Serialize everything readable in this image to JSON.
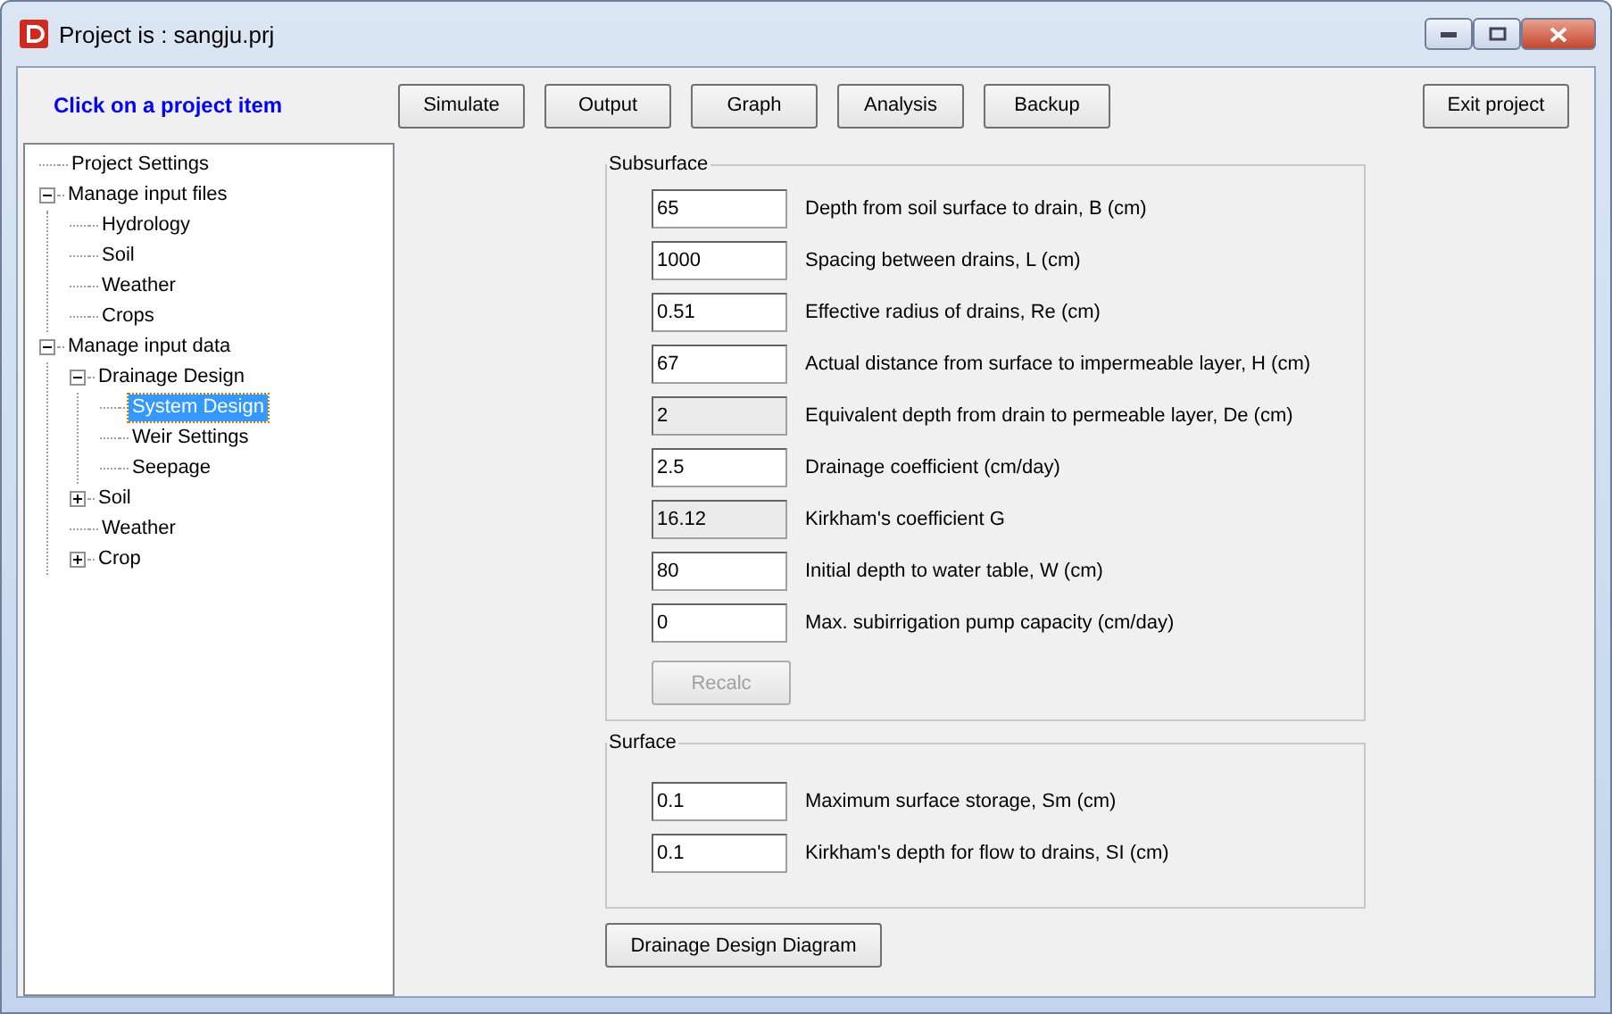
{
  "window": {
    "title": "Project is : sangju.prj"
  },
  "hint": "Click on a project item",
  "toolbar": [
    {
      "label": "Simulate"
    },
    {
      "label": "Output"
    },
    {
      "label": "Graph"
    },
    {
      "label": "Analysis"
    },
    {
      "label": "Backup"
    }
  ],
  "exit_button": "Exit project",
  "tree": [
    {
      "label": "Project Settings",
      "selected": false
    },
    {
      "label": "Manage input files",
      "selected": false,
      "expanded": true,
      "children": [
        {
          "label": "Hydrology",
          "selected": false
        },
        {
          "label": "Soil",
          "selected": false
        },
        {
          "label": "Weather",
          "selected": false
        },
        {
          "label": "Crops",
          "selected": false
        }
      ]
    },
    {
      "label": "Manage input data",
      "selected": false,
      "expanded": true,
      "children": [
        {
          "label": "Drainage Design",
          "selected": false,
          "expanded": true,
          "children": [
            {
              "label": "System Design",
              "selected": true
            },
            {
              "label": "Weir Settings",
              "selected": false
            },
            {
              "label": "Seepage",
              "selected": false
            }
          ]
        },
        {
          "label": "Soil",
          "selected": false,
          "expanded": false
        },
        {
          "label": "Weather",
          "selected": false
        },
        {
          "label": "Crop",
          "selected": false,
          "expanded": false
        }
      ]
    }
  ],
  "subsurface": {
    "title": "Subsurface",
    "fields": [
      {
        "value": "65",
        "label": "Depth from soil surface to drain, B (cm)",
        "disabled": false
      },
      {
        "value": "1000",
        "label": "Spacing between drains, L (cm)",
        "disabled": false
      },
      {
        "value": "0.51",
        "label": "Effective radius of drains, Re (cm)",
        "disabled": false
      },
      {
        "value": "67",
        "label": "Actual distance from surface to impermeable layer, H (cm)",
        "disabled": false
      },
      {
        "value": "2",
        "label": "Equivalent depth from drain to permeable layer, De (cm)",
        "disabled": true
      },
      {
        "value": "2.5",
        "label": "Drainage coefficient (cm/day)",
        "disabled": false
      },
      {
        "value": "16.12",
        "label": "Kirkham's coefficient G",
        "disabled": true
      },
      {
        "value": "80",
        "label": "Initial depth to water table, W (cm)",
        "disabled": false
      },
      {
        "value": "0",
        "label": "Max. subirrigation pump capacity (cm/day)",
        "disabled": false
      }
    ],
    "recalc": {
      "label": "Recalc",
      "disabled": true
    }
  },
  "surface": {
    "title": "Surface",
    "fields": [
      {
        "value": "0.1",
        "label": "Maximum surface storage, Sm (cm)",
        "disabled": false
      },
      {
        "value": "0.1",
        "label": "Kirkham's depth for flow to drains, SI (cm)",
        "disabled": false
      }
    ]
  },
  "diagram_button": "Drainage Design Diagram"
}
